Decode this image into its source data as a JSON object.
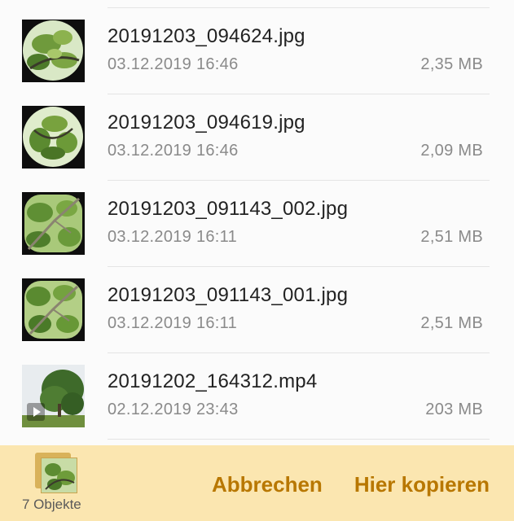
{
  "files": [
    {
      "name": "20191203_094624.jpg",
      "date": "03.12.2019 16:46",
      "size": "2,35 MB",
      "type": "image",
      "thumb_icon": "leaf-photo-thumbnail"
    },
    {
      "name": "20191203_094619.jpg",
      "date": "03.12.2019 16:46",
      "size": "2,09 MB",
      "type": "image",
      "thumb_icon": "leaf-photo-thumbnail"
    },
    {
      "name": "20191203_091143_002.jpg",
      "date": "03.12.2019 16:11",
      "size": "2,51 MB",
      "type": "image",
      "thumb_icon": "branch-photo-thumbnail"
    },
    {
      "name": "20191203_091143_001.jpg",
      "date": "03.12.2019 16:11",
      "size": "2,51 MB",
      "type": "image",
      "thumb_icon": "branch-photo-thumbnail"
    },
    {
      "name": "20191202_164312.mp4",
      "date": "02.12.2019 23:43",
      "size": "203 MB",
      "type": "video",
      "thumb_icon": "tree-video-thumbnail"
    }
  ],
  "bottom_bar": {
    "selection_count": "7 Objekte",
    "cancel_label": "Abbrechen",
    "copy_label": "Hier kopieren"
  },
  "colors": {
    "bottom_bar_bg": "#fbe6b0",
    "action_text": "#b87700"
  }
}
